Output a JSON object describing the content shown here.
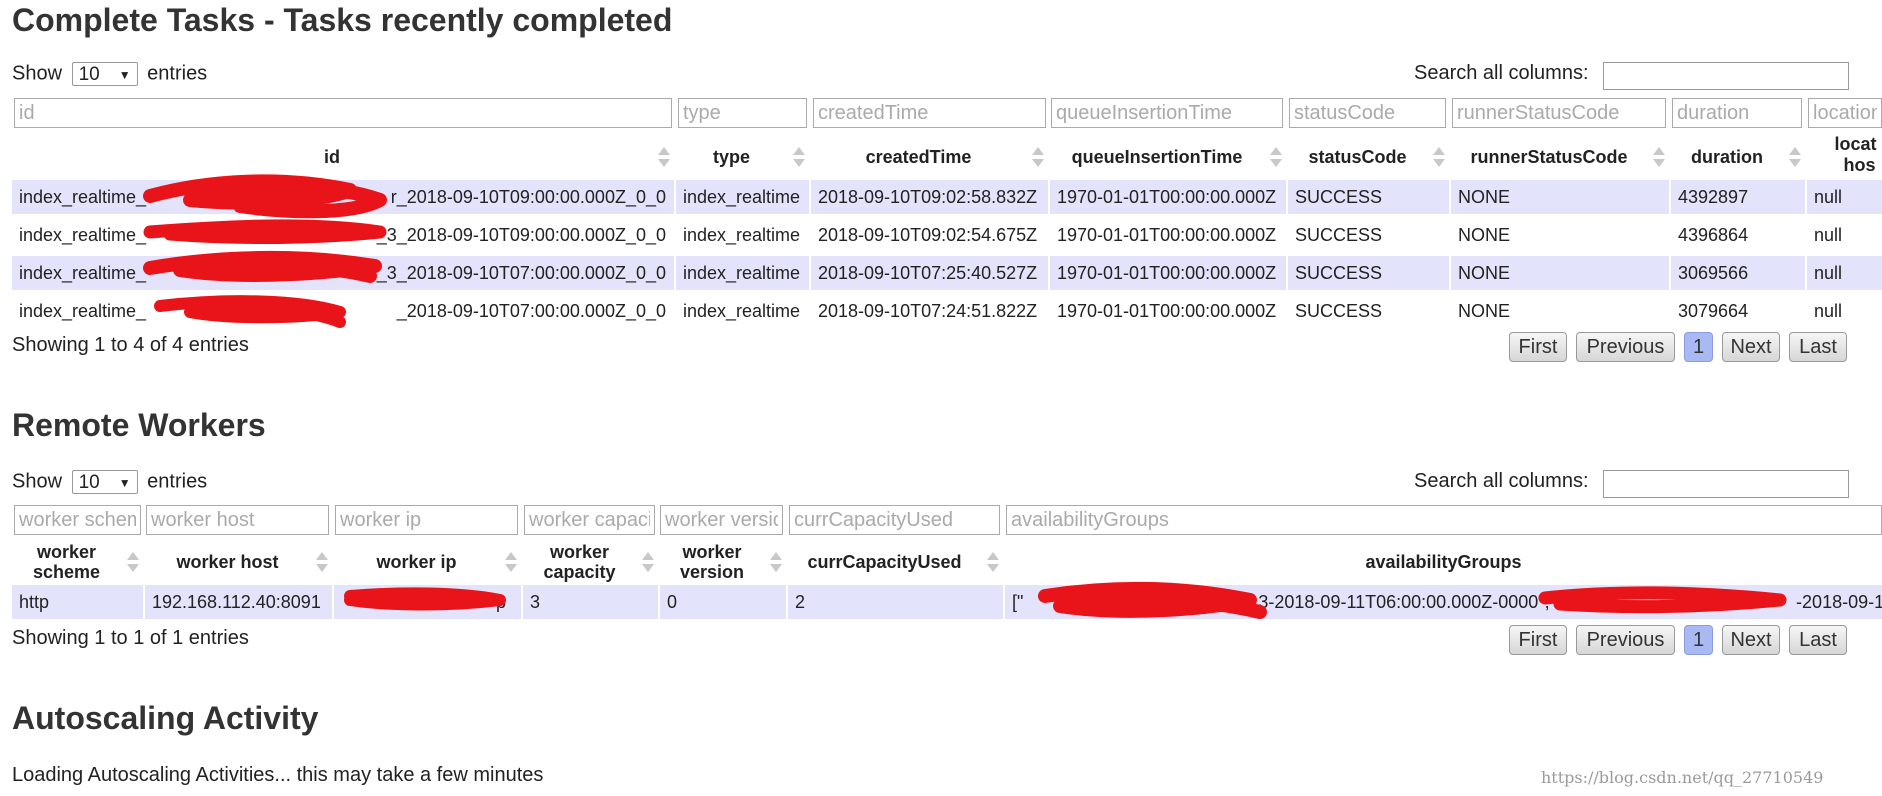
{
  "complete_tasks": {
    "title": "Complete Tasks - Tasks recently completed",
    "show_label": "Show",
    "entries_label": "entries",
    "page_size": "10",
    "search_label": "Search all columns:",
    "search_value": "",
    "filters": [
      "id",
      "type",
      "createdTime",
      "queueInsertionTime",
      "statusCode",
      "runnerStatusCode",
      "duration",
      "location"
    ],
    "headers": [
      "id",
      "type",
      "createdTime",
      "queueInsertionTime",
      "statusCode",
      "runnerStatusCode",
      "duration",
      "locat",
      "hos"
    ],
    "rows": [
      {
        "id_prefix": "index_realtime_",
        "id_suffix": "r_2018-09-10T09:00:00.000Z_0_0",
        "type": "index_realtime",
        "createdTime": "2018-09-10T09:02:58.832Z",
        "queueInsertionTime": "1970-01-01T00:00:00.000Z",
        "statusCode": "SUCCESS",
        "runnerStatusCode": "NONE",
        "duration": "4392897",
        "location": "null"
      },
      {
        "id_prefix": "index_realtime_",
        "id_suffix": "_3_2018-09-10T09:00:00.000Z_0_0",
        "type": "index_realtime",
        "createdTime": "2018-09-10T09:02:54.675Z",
        "queueInsertionTime": "1970-01-01T00:00:00.000Z",
        "statusCode": "SUCCESS",
        "runnerStatusCode": "NONE",
        "duration": "4396864",
        "location": "null"
      },
      {
        "id_prefix": "index_realtime_",
        "id_suffix": "_3_2018-09-10T07:00:00.000Z_0_0",
        "type": "index_realtime",
        "createdTime": "2018-09-10T07:25:40.527Z",
        "queueInsertionTime": "1970-01-01T00:00:00.000Z",
        "statusCode": "SUCCESS",
        "runnerStatusCode": "NONE",
        "duration": "3069566",
        "location": "null"
      },
      {
        "id_prefix": "index_realtime_",
        "id_suffix": "_2018-09-10T07:00:00.000Z_0_0",
        "type": "index_realtime",
        "createdTime": "2018-09-10T07:24:51.822Z",
        "queueInsertionTime": "1970-01-01T00:00:00.000Z",
        "statusCode": "SUCCESS",
        "runnerStatusCode": "NONE",
        "duration": "3079664",
        "location": "null"
      }
    ],
    "info": "Showing 1 to 4 of 4 entries",
    "pagination": {
      "first": "First",
      "previous": "Previous",
      "current": "1",
      "next": "Next",
      "last": "Last"
    }
  },
  "remote_workers": {
    "title": "Remote Workers",
    "show_label": "Show",
    "entries_label": "entries",
    "page_size": "10",
    "search_label": "Search all columns:",
    "search_value": "",
    "filters": [
      "worker scheme",
      "worker host",
      "worker ip",
      "worker capacity",
      "worker version",
      "currCapacityUsed",
      "availabilityGroups"
    ],
    "headers": [
      "worker\nscheme",
      "worker host",
      "worker ip",
      "worker\ncapacity",
      "worker\nversion",
      "currCapacityUsed",
      "availabilityGroups"
    ],
    "rows": [
      {
        "scheme": "http",
        "host": "192.168.112.40:8091",
        "ip": "p",
        "capacity": "3",
        "version": "0",
        "used": "2",
        "groups_prefix": "[\"",
        "groups_mid": "3-2018-09-11T06:00:00.000Z-0000\",\"",
        "groups_suffix": "-2018-09-1"
      }
    ],
    "info": "Showing 1 to 1 of 1 entries",
    "pagination": {
      "first": "First",
      "previous": "Previous",
      "current": "1",
      "next": "Next",
      "last": "Last"
    }
  },
  "autoscaling": {
    "title": "Autoscaling Activity",
    "loading_text": "Loading Autoscaling Activities... this may take a few minutes"
  },
  "watermark": "https://blog.csdn.net/qq_27710549",
  "colors": {
    "odd_row": "#e3e3fb",
    "current_page": "#a9b9f3",
    "redaction": "#e8141a"
  }
}
